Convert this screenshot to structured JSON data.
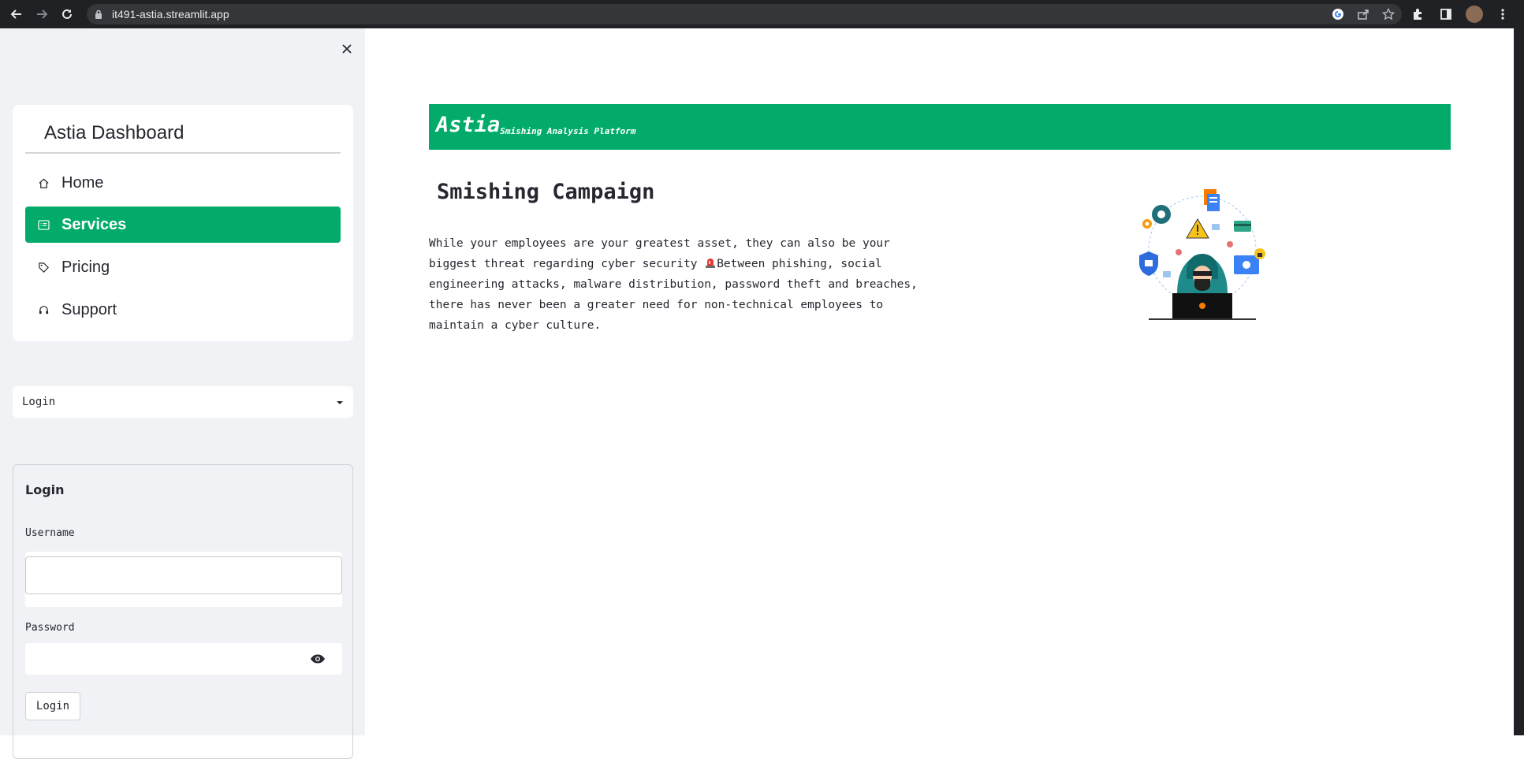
{
  "browser": {
    "url": "it491-astia.streamlit.app"
  },
  "sidebar": {
    "menu_title": "Astia Dashboard",
    "items": [
      {
        "label": "Home",
        "icon": "house-icon",
        "active": false
      },
      {
        "label": "Services",
        "icon": "card-list-icon",
        "active": true
      },
      {
        "label": "Pricing",
        "icon": "tag-icon",
        "active": false
      },
      {
        "label": "Support",
        "icon": "headset-icon",
        "active": false
      }
    ],
    "select": {
      "value": "Login"
    },
    "login_form": {
      "title": "Login",
      "username_label": "Username",
      "username_value": "",
      "password_label": "Password",
      "password_value": "",
      "button_label": "Login"
    }
  },
  "main": {
    "banner": {
      "brand": "Astia",
      "tagline": "Smishing Analysis Platform"
    },
    "title": "Smishing Campaign",
    "body_part1": "While your employees are your greatest asset, they can also be your biggest threat regarding cyber security ",
    "body_part2": "Between phishing, social engineering attacks, malware distribution, password theft and breaches, there has never been a greater need for non-technical employees to maintain a cyber culture."
  },
  "colors": {
    "accent": "#02ab6a",
    "sidebar_bg": "#f0f2f6",
    "text": "#262730"
  }
}
